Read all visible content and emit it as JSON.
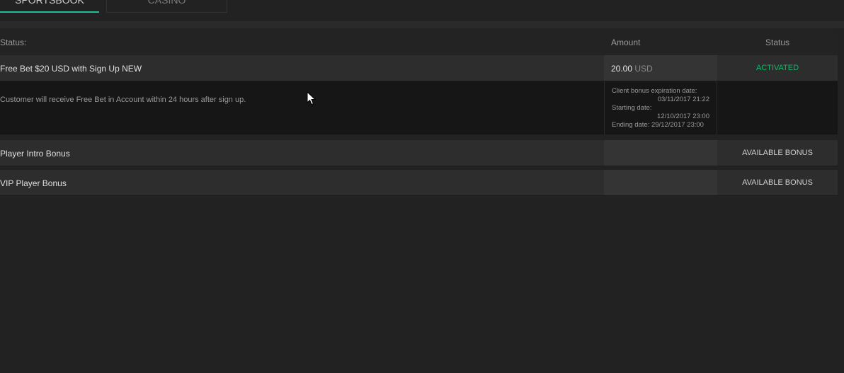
{
  "tabs": [
    {
      "label": "SPORTSBOOK",
      "active": true
    },
    {
      "label": "CASINO",
      "active": false
    }
  ],
  "table": {
    "headers": {
      "status": "Status:",
      "amount": "Amount",
      "status2": "Status"
    },
    "rows": [
      {
        "name": "Free Bet $20 USD with Sign Up NEW",
        "amount": "20.00",
        "currency": "USD",
        "status": "ACTIVATED",
        "description": "Customer will receive Free Bet in Account within 24 hours after sign up.",
        "expiration_label": "Client bonus expiration date:",
        "expiration_value": "03/11/2017 21:22",
        "starting_label": "Starting date:",
        "starting_value": "12/10/2017 23:00",
        "ending_text": "Ending date: 29/12/2017 23:00"
      },
      {
        "name": "Player Intro Bonus",
        "status": "AVAILABLE BONUS"
      },
      {
        "name": "VIP Player Bonus",
        "status": "AVAILABLE BONUS"
      }
    ]
  },
  "colors": {
    "accent": "#1fc194",
    "activated": "#17b86a",
    "background": "#222222"
  }
}
